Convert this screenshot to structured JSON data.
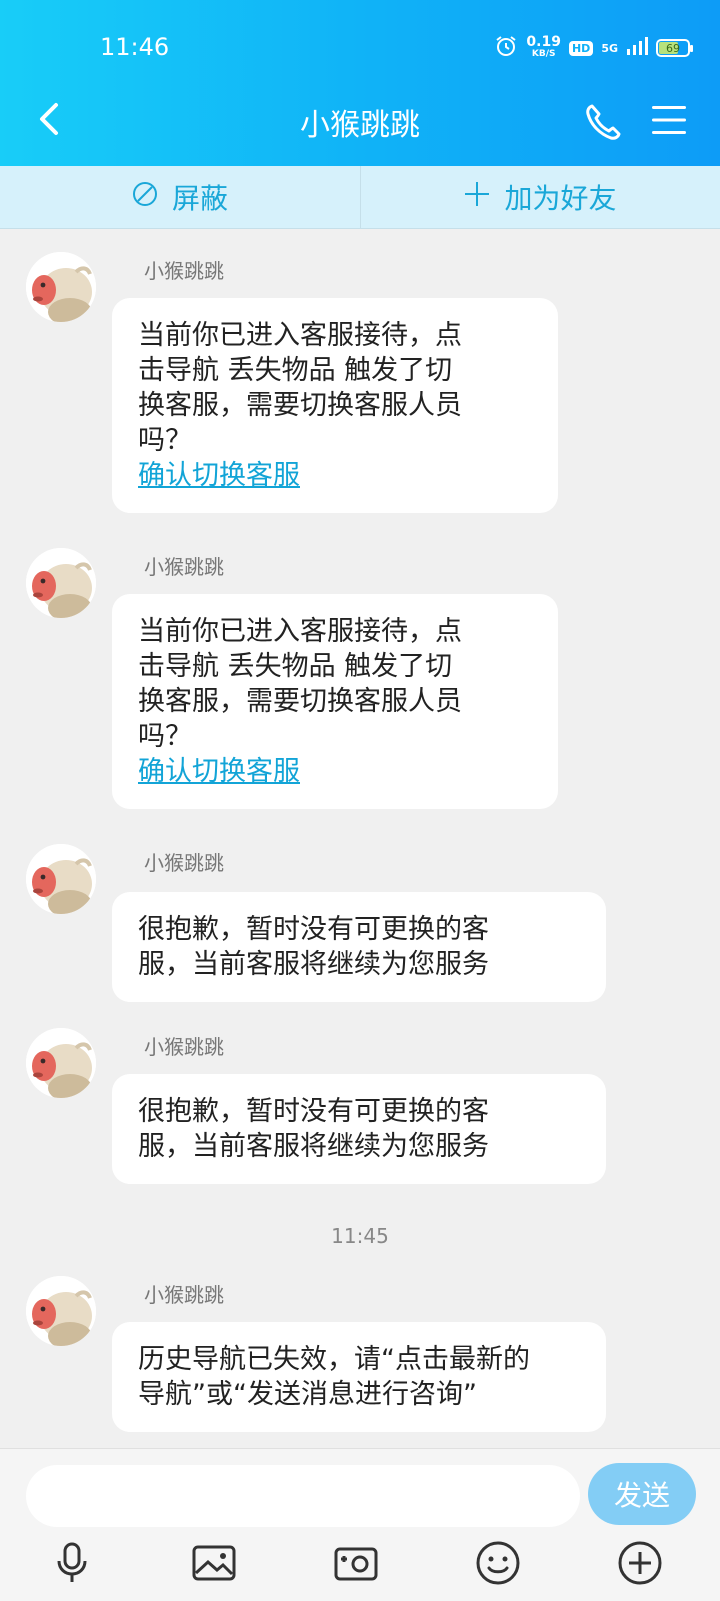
{
  "status_bar": {
    "time": "11:46",
    "net_speed": "0.19",
    "net_speed_unit": "KB/S",
    "hd": "HD",
    "network": "5G",
    "battery": "69",
    "battery_level": 0.69
  },
  "header": {
    "title": "小猴跳跳",
    "icons": [
      "back-icon",
      "phone-icon",
      "menu-icon"
    ]
  },
  "action_bar": {
    "block_label": "屏蔽",
    "add_friend_label": "加为好友"
  },
  "messages": [
    {
      "sender": "小猴跳跳",
      "lines": [
        "当前你已进入客服接待，点",
        "击导航 丢失物品 触发了切",
        "换客服，需要切换客服人员",
        "吗？"
      ],
      "link": "确认切换客服"
    },
    {
      "sender": "小猴跳跳",
      "lines": [
        "当前你已进入客服接待，点",
        "击导航 丢失物品 触发了切",
        "换客服，需要切换客服人员",
        "吗？"
      ],
      "link": "确认切换客服"
    },
    {
      "sender": "小猴跳跳",
      "lines": [
        "很抱歉，暂时没有可更换的客",
        "服，当前客服将继续为您服务"
      ]
    },
    {
      "sender": "小猴跳跳",
      "lines": [
        "很抱歉，暂时没有可更换的客",
        "服，当前客服将继续为您服务"
      ]
    },
    {
      "sender": "小猴跳跳",
      "lines": [
        "历史导航已失效，请“点击最新的",
        "导航”或“发送消息进行咨询”"
      ]
    }
  ],
  "timestamp": "11:45",
  "composer": {
    "placeholder": "",
    "value": "",
    "send_label": "发送",
    "toolbar_icons": [
      "microphone-icon",
      "image-icon",
      "camera-icon",
      "emoji-icon",
      "plus-icon"
    ]
  },
  "colors": {
    "header_gradient_start": "#18cdf8",
    "header_gradient_end": "#0d9cf7",
    "link": "#12a4d7",
    "send_button": "#83cdf5"
  }
}
